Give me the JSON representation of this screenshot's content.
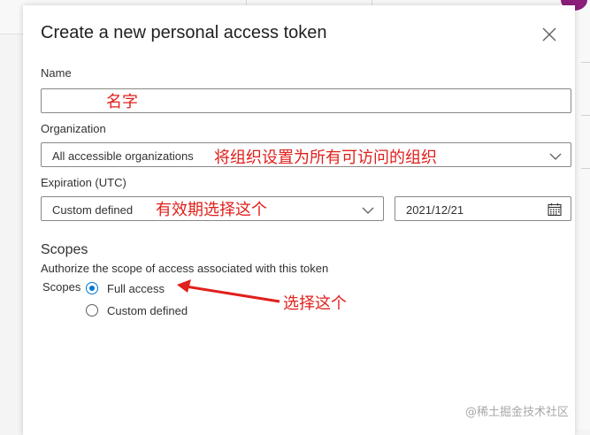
{
  "dialog": {
    "title": "Create a new personal access token"
  },
  "form": {
    "name": {
      "label": "Name",
      "value": ""
    },
    "organization": {
      "label": "Organization",
      "value": "All accessible organizations"
    },
    "expiration": {
      "label": "Expiration (UTC)",
      "value": "Custom defined",
      "date": "2021/12/21"
    }
  },
  "scopes": {
    "heading": "Scopes",
    "description": "Authorize the scope of access associated with this token",
    "group_label": "Scopes",
    "options": [
      {
        "label": "Full access",
        "selected": true
      },
      {
        "label": "Custom defined",
        "selected": false
      }
    ]
  },
  "annotations": {
    "name": "名字",
    "organization": "将组织设置为所有可访问的组织",
    "expiration": "有效期选择这个",
    "scopes": "选择这个"
  },
  "colors": {
    "accent": "#0078d4",
    "annotation": "#e0201c"
  },
  "icons": [
    "close-icon",
    "chevron-down-icon",
    "calendar-icon",
    "arrow-annotation"
  ],
  "watermark": "@稀土掘金技术社区"
}
